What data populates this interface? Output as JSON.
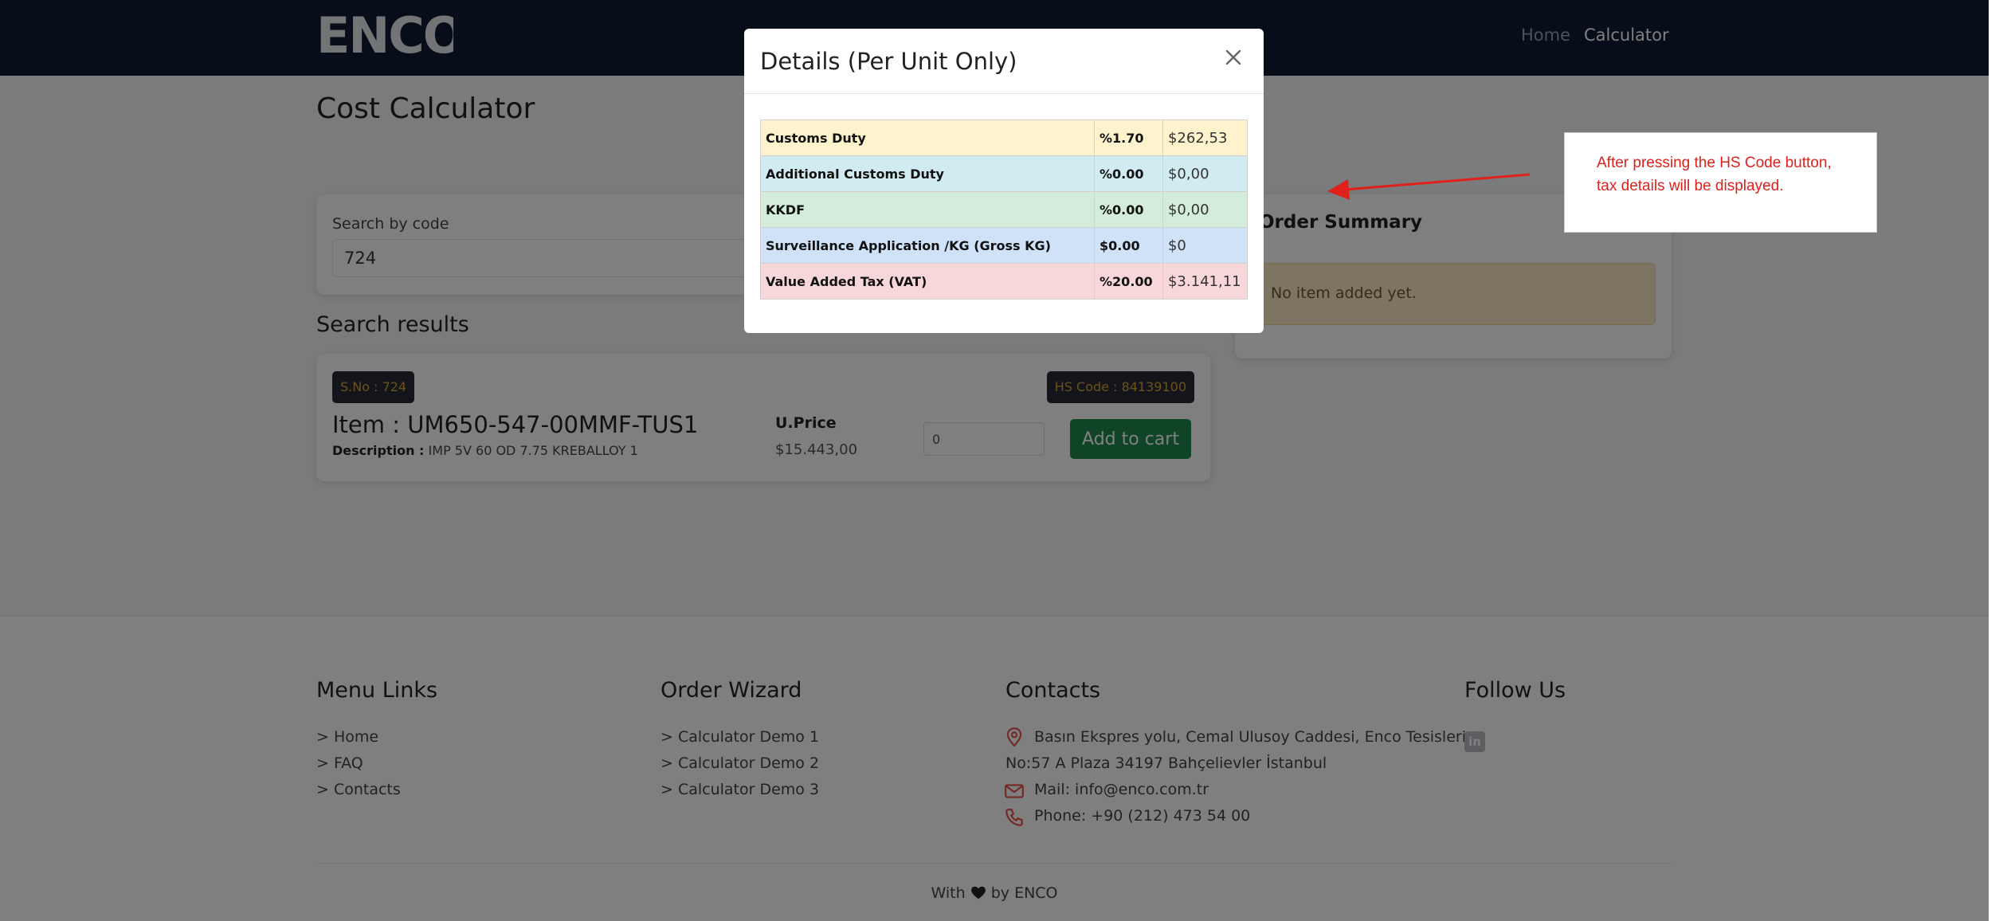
{
  "header": {
    "logo_text": "ENCO",
    "nav": [
      {
        "label": "Home",
        "active": false
      },
      {
        "label": "Calculator",
        "active": true
      }
    ]
  },
  "page": {
    "title": "Cost Calculator"
  },
  "search": {
    "label": "Search by code",
    "value": "724",
    "results_title": "Search results"
  },
  "result": {
    "sno": "S.No : 724",
    "hs_code": "HS Code : 84139100",
    "item": "Item : UM650-547-00MMF-TUS1",
    "description_label": "Description :",
    "description_value": " IMP 5V 60 OD 7.75 KREBALLOY 1",
    "uprice_label": "U.Price",
    "uprice_value": "$15.443,00",
    "qty_value": "0",
    "add_label": "Add to cart"
  },
  "summary": {
    "title": "Order Summary",
    "empty_message": "No item added yet."
  },
  "modal": {
    "title": "Details (Per Unit Only)",
    "rows": [
      {
        "name": "Customs Duty",
        "rate": "%1.70",
        "amount": "$262,53",
        "color": "#fff3cd"
      },
      {
        "name": "Additional Customs Duty",
        "rate": "%0.00",
        "amount": "$0,00",
        "color": "#d1ecf1"
      },
      {
        "name": "KKDF",
        "rate": "%0.00",
        "amount": "$0,00",
        "color": "#d4edda"
      },
      {
        "name": "Surveillance Application /KG (Gross KG)",
        "rate": "$0.00",
        "amount": "$0",
        "color": "#cfe2f7"
      },
      {
        "name": "Value Added Tax (VAT)",
        "rate": "%20.00",
        "amount": "$3.141,11",
        "color": "#f8d7da"
      }
    ]
  },
  "footer": {
    "menu_title": "Menu Links",
    "menu_links": [
      "> Home",
      "> FAQ",
      "> Contacts"
    ],
    "wizard_title": "Order Wizard",
    "wizard_links": [
      "> Calculator Demo 1",
      "> Calculator Demo 2",
      "> Calculator Demo 3"
    ],
    "contacts_title": "Contacts",
    "address_line1": "Basın Ekspres yolu, Cemal Ulusoy Caddesi, Enco Tesisleri",
    "address_line2": "No:57 A Plaza 34197 Bahçelievler İstanbul",
    "mail": "Mail: info@enco.com.tr",
    "phone": "Phone: +90 (212) 473 54 00",
    "follow_title": "Follow Us",
    "linkedin_label": "in",
    "credit_prefix": "With",
    "credit_suffix": "by ENCO"
  },
  "annotation": {
    "text": "After pressing the HS Code button, tax details will be displayed.",
    "color": "#e0201b"
  },
  "colors": {
    "header_bg": "#0f1b33",
    "accent_green": "#1f8a4c",
    "badge_text": "#d8a235"
  }
}
